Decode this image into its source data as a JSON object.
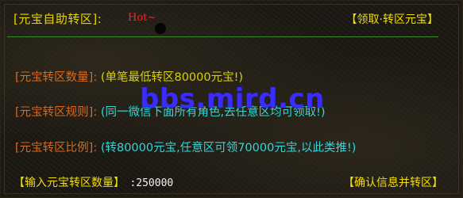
{
  "header": {
    "title": "[元宝自助转区]:",
    "hot": "Hot~",
    "claim_link": "【领取·转区元宝】"
  },
  "rules": [
    {
      "label": "[元宝转区数量]:",
      "value": "(单笔最低转区80000元宝!)",
      "value_color": "#d7d200"
    },
    {
      "label": "[元宝转区规则]:",
      "value": "(同一微信下面所有角色,去任意区均可领取!)",
      "value_color": "#2fd8d8"
    },
    {
      "label": "[元宝转区比例]:",
      "value": "(转80000元宝,任意区可领70000元宝,以此类推!)",
      "value_color": "#2fd8d8"
    }
  ],
  "watermark": "bbs.mird.cn",
  "input": {
    "label": "【输入元宝转区数量】",
    "value": ":250000"
  },
  "confirm_link": "【确认信息并转区】",
  "colors": {
    "title": "#e6d400",
    "label_orange": "#d96a1f",
    "hot_red": "#ff2020",
    "divider_green": "#3f8a2a",
    "watermark_blue": "#3a2cff"
  }
}
